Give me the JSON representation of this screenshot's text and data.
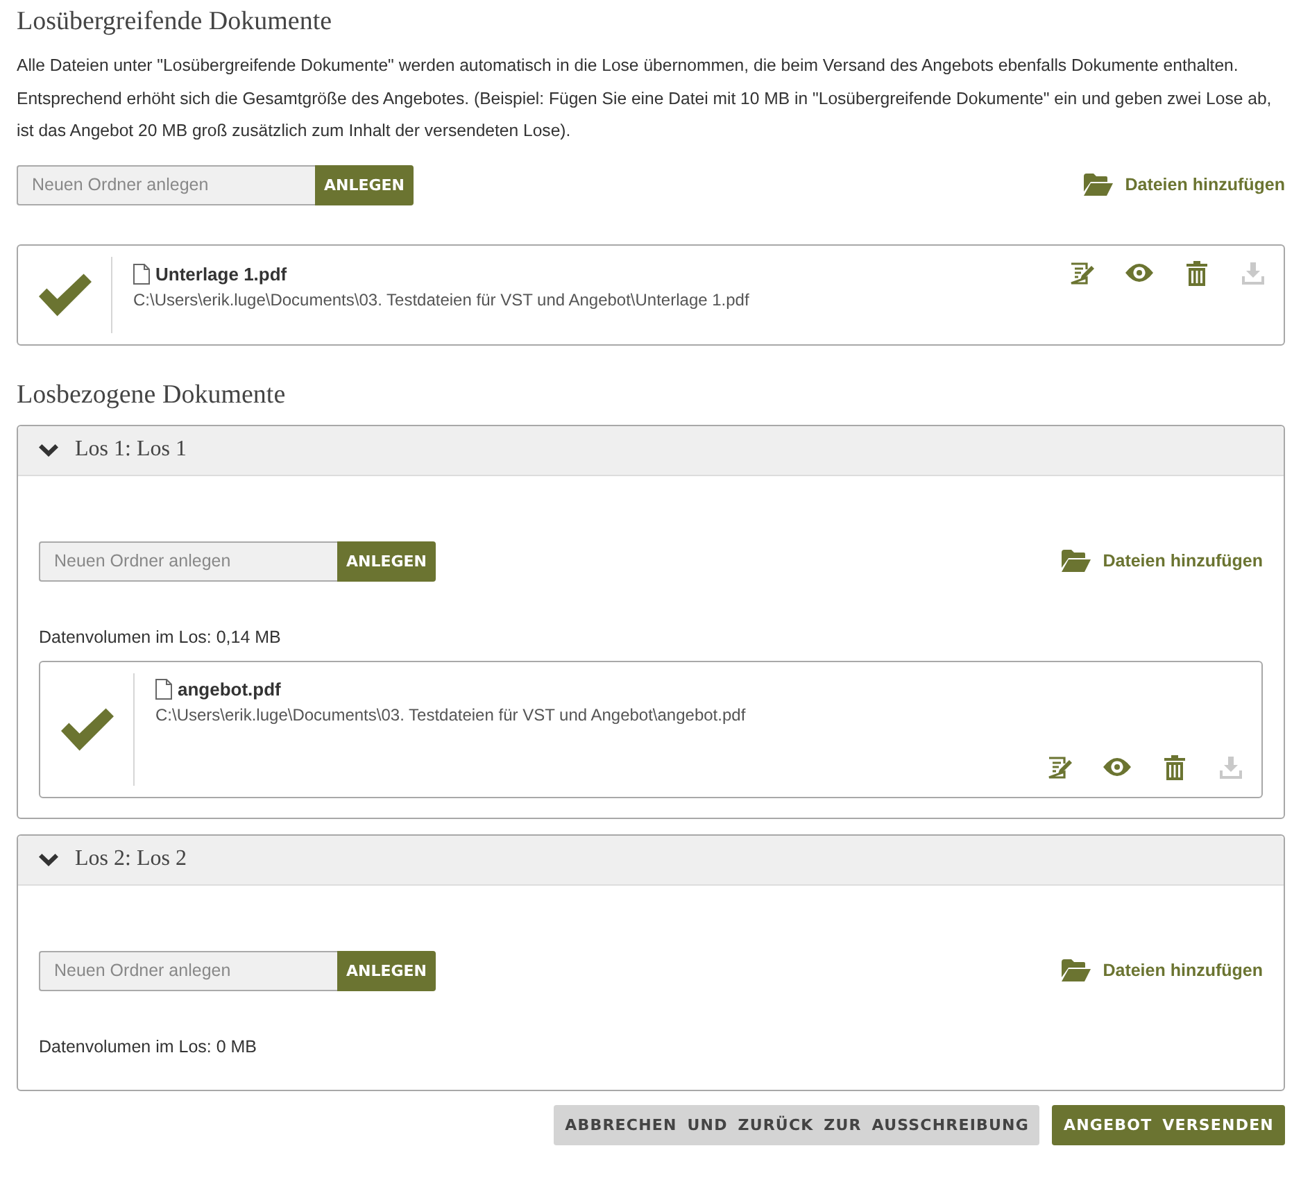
{
  "general_section": {
    "title": "Losübergreifende Dokumente",
    "description": "Alle Dateien unter \"Losübergreifende Dokumente\" werden automatisch in die Lose übernommen, die beim Versand des Angebots ebenfalls Dokumente enthalten. Entsprechend erhöht sich die Gesamtgröße des Angebotes. (Beispiel: Fügen Sie eine Datei mit 10 MB in \"Losübergreifende Dokumente\" ein und geben zwei Lose ab, ist das Angebot 20 MB groß zusätzlich zum Inhalt der versendeten Lose).",
    "folder_form": {
      "placeholder": "Neuen Ordner anlegen",
      "button": "ANLEGEN"
    },
    "add_files": "Dateien hinzufügen",
    "files": [
      {
        "name": "Unterlage 1.pdf",
        "path": "C:\\Users\\erik.luge\\Documents\\03. Testdateien für VST und Angebot\\Unterlage 1.pdf",
        "uploaded": true,
        "actions": [
          {
            "kind": "edit",
            "disabled": false
          },
          {
            "kind": "view",
            "disabled": false
          },
          {
            "kind": "delete",
            "disabled": false
          },
          {
            "kind": "download",
            "disabled": true
          }
        ]
      }
    ]
  },
  "lots_section": {
    "title": "Losbezogene Dokumente",
    "lots": [
      {
        "title": "Los 1: Los 1",
        "expanded": true,
        "folder_form": {
          "placeholder": "Neuen Ordner anlegen",
          "button": "ANLEGEN"
        },
        "add_files": "Dateien hinzufügen",
        "volume": "Datenvolumen im Los: 0,14 MB",
        "files": [
          {
            "name": "angebot.pdf",
            "path": "C:\\Users\\erik.luge\\Documents\\03. Testdateien für VST und Angebot\\angebot.pdf",
            "uploaded": true,
            "actions": [
              {
                "kind": "edit",
                "disabled": false
              },
              {
                "kind": "view",
                "disabled": false
              },
              {
                "kind": "delete",
                "disabled": false
              },
              {
                "kind": "download",
                "disabled": true
              }
            ]
          }
        ]
      },
      {
        "title": "Los 2: Los 2",
        "expanded": true,
        "folder_form": {
          "placeholder": "Neuen Ordner anlegen",
          "button": "ANLEGEN"
        },
        "add_files": "Dateien hinzufügen",
        "volume": "Datenvolumen im Los: 0 MB"
      }
    ]
  },
  "buttons": [
    {
      "label": "ABBRECHEN UND ZURÜCK ZUR AUSSCHREIBUNG",
      "kind": "secondary"
    },
    {
      "label": "ANGEBOT VERSENDEN",
      "kind": "primary"
    }
  ]
}
